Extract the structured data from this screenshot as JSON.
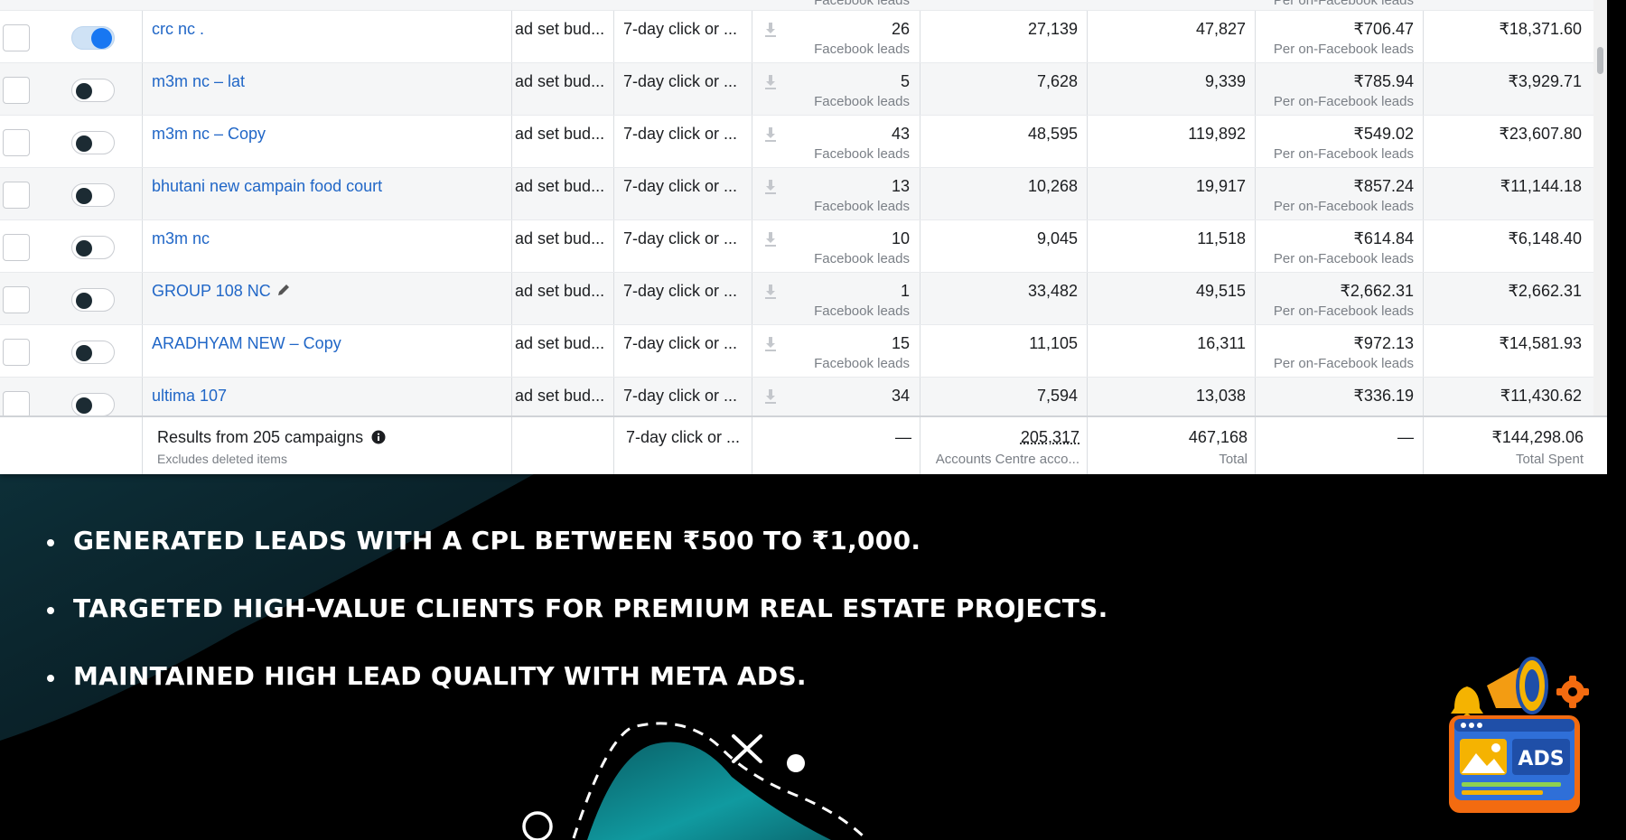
{
  "table": {
    "rows": [
      {
        "toggle_on": true,
        "name": "crc nc .",
        "budget": "ad set bud...",
        "attribution": "7-day click or ...",
        "results": "26",
        "results_label": "Facebook leads",
        "reach": "27,139",
        "impressions": "47,827",
        "cost_per_result": "₹706.47",
        "cost_label": "Per on-Facebook leads",
        "amount_spent": "₹18,371.60"
      },
      {
        "toggle_on": false,
        "name": "m3m nc – lat",
        "budget": "ad set bud...",
        "attribution": "7-day click or ...",
        "results": "5",
        "results_label": "Facebook leads",
        "reach": "7,628",
        "impressions": "9,339",
        "cost_per_result": "₹785.94",
        "cost_label": "Per on-Facebook leads",
        "amount_spent": "₹3,929.71"
      },
      {
        "toggle_on": false,
        "name": "m3m nc – Copy",
        "budget": "ad set bud...",
        "attribution": "7-day click or ...",
        "results": "43",
        "results_label": "Facebook leads",
        "reach": "48,595",
        "impressions": "119,892",
        "cost_per_result": "₹549.02",
        "cost_label": "Per on-Facebook leads",
        "amount_spent": "₹23,607.80"
      },
      {
        "toggle_on": false,
        "name": "bhutani new campain food court",
        "budget": "ad set bud...",
        "attribution": "7-day click or ...",
        "results": "13",
        "results_label": "Facebook leads",
        "reach": "10,268",
        "impressions": "19,917",
        "cost_per_result": "₹857.24",
        "cost_label": "Per on-Facebook leads",
        "amount_spent": "₹11,144.18"
      },
      {
        "toggle_on": false,
        "name": "m3m nc",
        "budget": "ad set bud...",
        "attribution": "7-day click or ...",
        "results": "10",
        "results_label": "Facebook leads",
        "reach": "9,045",
        "impressions": "11,518",
        "cost_per_result": "₹614.84",
        "cost_label": "Per on-Facebook leads",
        "amount_spent": "₹6,148.40"
      },
      {
        "toggle_on": false,
        "name": "GROUP 108 NC",
        "budget": "ad set bud...",
        "attribution": "7-day click or ...",
        "results": "1",
        "results_label": "Facebook leads",
        "reach": "33,482",
        "impressions": "49,515",
        "cost_per_result": "₹2,662.31",
        "cost_label": "Per on-Facebook leads",
        "amount_spent": "₹2,662.31"
      },
      {
        "toggle_on": false,
        "name": "ARADHYAM NEW – Copy",
        "budget": "ad set bud...",
        "attribution": "7-day click or ...",
        "results": "15",
        "results_label": "Facebook leads",
        "reach": "11,105",
        "impressions": "16,311",
        "cost_per_result": "₹972.13",
        "cost_label": "Per on-Facebook leads",
        "amount_spent": "₹14,581.93"
      },
      {
        "toggle_on": false,
        "name": "ultima 107",
        "budget": "ad set bud...",
        "attribution": "7-day click or ...",
        "results": "34",
        "results_label": "",
        "reach": "7,594",
        "impressions": "13,038",
        "cost_per_result": "₹336.19",
        "cost_label": "",
        "amount_spent": "₹11,430.62"
      }
    ],
    "top_partial": {
      "results_label": "Facebook leads",
      "cost_label": "Per on-Facebook leads"
    },
    "footer": {
      "title": "Results from 205 campaigns",
      "subtitle": "Excludes deleted items",
      "attribution": "7-day click or ...",
      "results": "—",
      "reach": "205,317",
      "reach_label": "Accounts Centre acco...",
      "impressions": "467,168",
      "impressions_label": "Total",
      "cost_per_result": "—",
      "amount_spent": "₹144,298.06",
      "amount_label": "Total Spent"
    }
  },
  "bullets": [
    "GENERATED LEADS WITH A CPL BETWEEN ₹500 TO ₹1,000.",
    "TARGETED HIGH-VALUE CLIENTS FOR PREMIUM REAL ESTATE PROJECTS.",
    "MAINTAINED HIGH LEAD QUALITY WITH META ADS."
  ],
  "illustration": {
    "label": "ADS"
  },
  "colors": {
    "background": "#000000",
    "teal_shape": "#0f7f86",
    "dark_teal_shape": "#0c2a33",
    "link_blue": "#2167c7",
    "toggle_blue": "#1877f2",
    "text_white": "#ffffff"
  }
}
